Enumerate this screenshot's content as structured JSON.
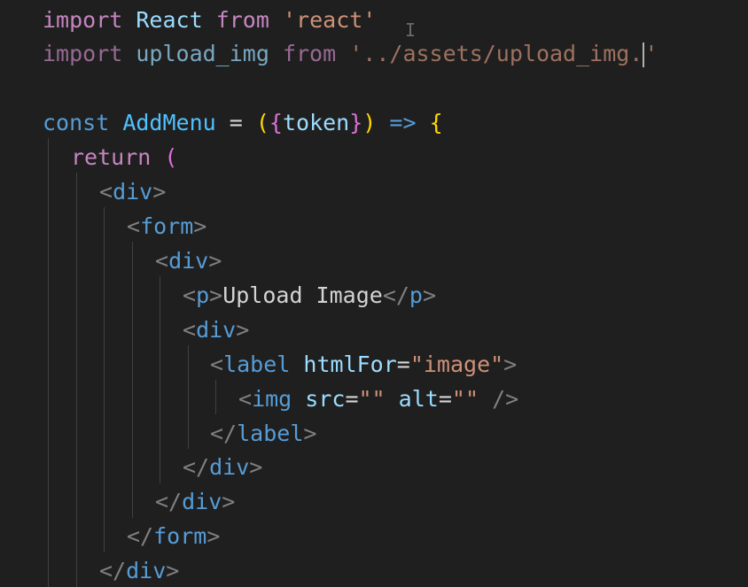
{
  "editor": {
    "lines": [
      {
        "id": "l1",
        "tokens": [
          [
            "kw",
            "import"
          ],
          [
            "pun",
            " "
          ],
          [
            "id",
            "React"
          ],
          [
            "pun",
            " "
          ],
          [
            "kw",
            "from"
          ],
          [
            "pun",
            " "
          ],
          [
            "str",
            "'react'"
          ]
        ]
      },
      {
        "id": "l2",
        "tokens": [
          [
            "kw",
            "import"
          ],
          [
            "pun",
            " "
          ],
          [
            "id",
            "upload_img"
          ],
          [
            "pun",
            " "
          ],
          [
            "kw",
            "from"
          ],
          [
            "pun",
            " "
          ],
          [
            "str",
            "'../assets/upload_img."
          ],
          [
            "cursor",
            ""
          ],
          [
            "str",
            "'"
          ]
        ],
        "faded": true
      },
      {
        "id": "l3",
        "tokens": []
      },
      {
        "id": "l4",
        "tokens": [
          [
            "kw2",
            "const"
          ],
          [
            "pun",
            " "
          ],
          [
            "fn",
            "AddMenu"
          ],
          [
            "pun",
            " = "
          ],
          [
            "br1",
            "("
          ],
          [
            "br2",
            "{"
          ],
          [
            "id",
            "token"
          ],
          [
            "br2",
            "}"
          ],
          [
            "br1",
            ")"
          ],
          [
            "pun",
            " "
          ],
          [
            "kw2",
            "=>"
          ],
          [
            "pun",
            " "
          ],
          [
            "br1",
            "{"
          ]
        ]
      },
      {
        "id": "l5",
        "tokens": [
          [
            "kw",
            "return"
          ],
          [
            "pun",
            " "
          ],
          [
            "br2",
            "("
          ]
        ]
      },
      {
        "id": "l6",
        "tokens": [
          [
            "tagb",
            "<"
          ],
          [
            "tag",
            "div"
          ],
          [
            "tagb",
            ">"
          ]
        ]
      },
      {
        "id": "l7",
        "tokens": [
          [
            "tagb",
            "<"
          ],
          [
            "tag",
            "form"
          ],
          [
            "tagb",
            ">"
          ]
        ]
      },
      {
        "id": "l8",
        "tokens": [
          [
            "tagb",
            "<"
          ],
          [
            "tag",
            "div"
          ],
          [
            "tagb",
            ">"
          ]
        ]
      },
      {
        "id": "l9",
        "tokens": [
          [
            "tagb",
            "<"
          ],
          [
            "tag",
            "p"
          ],
          [
            "tagb",
            ">"
          ],
          [
            "txt",
            "Upload Image"
          ],
          [
            "tagb",
            "</"
          ],
          [
            "tag",
            "p"
          ],
          [
            "tagb",
            ">"
          ]
        ]
      },
      {
        "id": "l10",
        "tokens": [
          [
            "tagb",
            "<"
          ],
          [
            "tag",
            "div"
          ],
          [
            "tagb",
            ">"
          ]
        ]
      },
      {
        "id": "l11",
        "tokens": [
          [
            "tagb",
            "<"
          ],
          [
            "tag",
            "label"
          ],
          [
            "pun",
            " "
          ],
          [
            "id",
            "htmlFor"
          ],
          [
            "pun",
            "="
          ],
          [
            "str",
            "\"image\""
          ],
          [
            "tagb",
            ">"
          ]
        ]
      },
      {
        "id": "l12",
        "tokens": [
          [
            "tagb",
            "<"
          ],
          [
            "tag",
            "img"
          ],
          [
            "pun",
            " "
          ],
          [
            "id",
            "src"
          ],
          [
            "pun",
            "="
          ],
          [
            "str",
            "\"\""
          ],
          [
            "pun",
            " "
          ],
          [
            "id",
            "alt"
          ],
          [
            "pun",
            "="
          ],
          [
            "str",
            "\"\""
          ],
          [
            "pun",
            " "
          ],
          [
            "tagb",
            "/>"
          ]
        ]
      },
      {
        "id": "l13",
        "tokens": [
          [
            "tagb",
            "</"
          ],
          [
            "tag",
            "label"
          ],
          [
            "tagb",
            ">"
          ]
        ]
      },
      {
        "id": "l14",
        "tokens": [
          [
            "tagb",
            "</"
          ],
          [
            "tag",
            "div"
          ],
          [
            "tagb",
            ">"
          ]
        ]
      },
      {
        "id": "l15",
        "tokens": [
          [
            "tagb",
            "</"
          ],
          [
            "tag",
            "div"
          ],
          [
            "tagb",
            ">"
          ]
        ]
      },
      {
        "id": "l16",
        "tokens": [
          [
            "tagb",
            "</"
          ],
          [
            "tag",
            "form"
          ],
          [
            "tagb",
            ">"
          ]
        ]
      },
      {
        "id": "l17",
        "tokens": [
          [
            "tagb",
            "</"
          ],
          [
            "tag",
            "div"
          ],
          [
            "tagb",
            ">"
          ]
        ]
      }
    ]
  },
  "colors": {
    "background": "#1f1f1f",
    "keyword_control": "#c586c0",
    "keyword_storage": "#569cd6",
    "identifier": "#9cdcfe",
    "function": "#4fc1ff",
    "string": "#ce9178",
    "bracket_1": "#ffd700",
    "bracket_2": "#da70d6"
  }
}
